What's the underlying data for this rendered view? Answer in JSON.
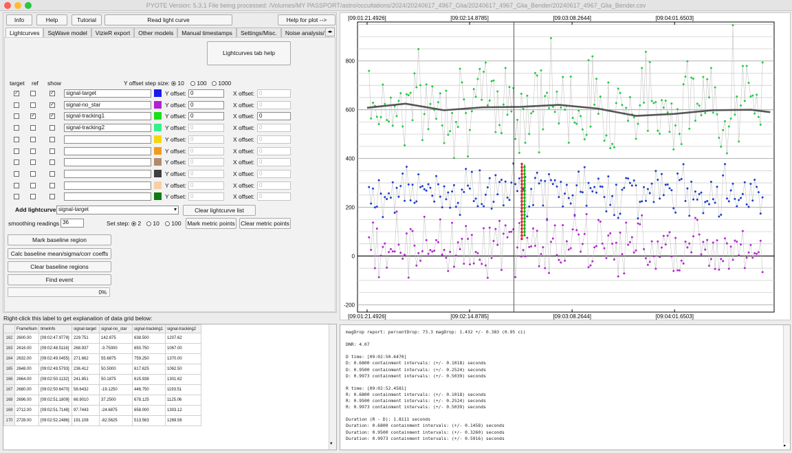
{
  "window": {
    "title": "PYOTE Version: 5.3.1  File being processed: /Volumes/MY PASSPORT/astro/occultations/2024/20240617_4967_Glia/20240617_4967_Glia_Bender/20240617_4967_Glia_Bender.csv"
  },
  "toolbar": {
    "info": "Info",
    "help": "Help",
    "tutorial": "Tutorial",
    "read": "Read light curve",
    "help_plot": "Help for plot -->"
  },
  "tabs": [
    "Lightcurves",
    "SqWave model",
    "VizieR export",
    "Other models",
    "Manual timestamps",
    "Settings/Misc.",
    "Noise analysis/"
  ],
  "lc_help": "Lightcurves tab help",
  "headers": {
    "target": "target",
    "ref": "ref",
    "show": "show"
  },
  "yoffset_label": "Y offset step size:",
  "yoffset_opts": [
    "10",
    "100",
    "1000"
  ],
  "row_labels": {
    "yoff": "Y offset:",
    "xoff": "X offset:"
  },
  "rows": [
    {
      "target": "✓",
      "ref": "",
      "show": "✓",
      "name": "signal-target",
      "color": "#1a1aee",
      "yoff": "0",
      "xoff": "0"
    },
    {
      "target": "",
      "ref": "",
      "show": "✓",
      "name": "signal-no_star",
      "color": "#b51ed6",
      "yoff": "0",
      "xoff": "0"
    },
    {
      "target": "",
      "ref": "✓",
      "show": "✓",
      "name": "signal-tracking1",
      "color": "#18e018",
      "yoff": "0",
      "xoff": "0"
    },
    {
      "target": "",
      "ref": "",
      "show": "",
      "name": "signal-tracking2",
      "color": "#36f08c",
      "yoff": "0",
      "xoff": "0"
    },
    {
      "target": "",
      "ref": "",
      "show": "",
      "name": "",
      "color": "#f5d50e",
      "yoff": "0",
      "xoff": "0"
    },
    {
      "target": "",
      "ref": "",
      "show": "",
      "name": "",
      "color": "#f09c1a",
      "yoff": "0",
      "xoff": "0"
    },
    {
      "target": "",
      "ref": "",
      "show": "",
      "name": "",
      "color": "#b48a6a",
      "yoff": "0",
      "xoff": "0"
    },
    {
      "target": "",
      "ref": "",
      "show": "",
      "name": "",
      "color": "#3e3e3e",
      "yoff": "0",
      "xoff": "0"
    },
    {
      "target": "",
      "ref": "",
      "show": "",
      "name": "",
      "color": "#f8cfa8",
      "yoff": "0",
      "xoff": "0"
    },
    {
      "target": "",
      "ref": "",
      "show": "",
      "name": "",
      "color": "#0f7a0f",
      "yoff": "0",
      "xoff": "0"
    }
  ],
  "add_lc": {
    "label": "Add lightcurve",
    "value": "signal-target",
    "clear": "Clear lightcurve list"
  },
  "smoothing": {
    "label": "smoothing readings",
    "value": "36"
  },
  "set_step": {
    "label": "Set step:",
    "opts": [
      "2",
      "10",
      "100"
    ]
  },
  "mark_metric": "Mark metric points",
  "clear_metric": "Clear metric points",
  "baseline": {
    "mark": "Mark baseline region",
    "calc": "Calc baseline mean/sigma/corr coeffs",
    "clear": "Clear baseline regions"
  },
  "find_event": "Find event",
  "progress": {
    "label": "0%",
    "value": 0
  },
  "grid_label": "Right-click this label to get explanation of data grid below:",
  "grid": {
    "columns": [
      "FrameNum",
      "timeInfo",
      "signal-target",
      "signal-no_star",
      "signal-tracking1",
      "signal-tracking2"
    ],
    "rows": [
      [
        "162",
        "2600.00",
        "[09:02:47.9778]",
        "229.751",
        "142.875",
        "638.500",
        "1207.62"
      ],
      [
        "163",
        "2616.00",
        "[09:02:48.5116]",
        "268.937",
        "-3.75000",
        "650.750",
        "1067.00"
      ],
      [
        "164",
        "2632.00",
        "[09:02:49.0455]",
        "271.662",
        "55.6875",
        "759.250",
        "1370.00"
      ],
      [
        "165",
        "2648.00",
        "[09:02:49.5793]",
        "236.412",
        "50.5000",
        "617.625",
        "1062.50"
      ],
      [
        "166",
        "2664.00",
        "[09:02:50.1132]",
        "241.851",
        "50.1875",
        "615.938",
        "1301.62"
      ],
      [
        "167",
        "2680.00",
        "[09:02:50.6470]",
        "58.6432",
        "-19.1250",
        "446.750",
        "1193.51"
      ],
      [
        "168",
        "2696.00",
        "[09:02:51.1809]",
        "66.9010",
        "37.2500",
        "678.125",
        "1125.06"
      ],
      [
        "169",
        "2712.00",
        "[09:02:51.7148]",
        "97.7443",
        "-24.6875",
        "658.000",
        "1303.12"
      ],
      [
        "170",
        "2728.00",
        "[09:02:52.2486]",
        "191.108",
        "-82.5625",
        "513.563",
        "1269.56"
      ]
    ]
  },
  "report_lines": [
    "magDrop report: percentDrop: 73.3 magDrop: 1.432 +/- 0.383 (0.95 ci)",
    "",
    "DNR: 4.07",
    "",
    "D time: [09:02:50.6470]",
    "D: 0.6800 containment intervals: (+/- 0.1018) seconds",
    "D: 0.9500 containment intervals: (+/- 0.2524) seconds",
    "D: 0.9973 containment intervals: (+/- 0.5039) seconds",
    "",
    "R time: [09:02:52.4581]",
    "R: 0.6800 containment intervals: (+/- 0.1018) seconds",
    "R: 0.9500 containment intervals: (+/- 0.2524) seconds",
    "R: 0.9973 containment intervals: (+/- 0.5039) seconds",
    "",
    "Duration (R - D): 1.8111 seconds",
    "Duration: 0.6800 containment intervals: (+/- 0.1458) seconds",
    "Duration: 0.9500 containment intervals: (+/- 0.3260) seconds",
    "Duration: 0.9973 containment intervals: (+/- 0.5916) seconds"
  ],
  "chart_data": {
    "type": "scatter",
    "x_ticks": [
      "[09:01:21.4926]",
      "[09:02:14.8785]",
      "[09:03:08.2644]",
      "[09:04:01.6503]"
    ],
    "y_ticks": [
      "800",
      "600",
      "400",
      "200",
      "0",
      "-200"
    ],
    "ylim": [
      -230,
      960
    ],
    "x_range_seconds": [
      -5,
      212
    ],
    "grid": true,
    "series": [
      {
        "color": "#22cc44",
        "mean": 620,
        "spread": 140
      },
      {
        "color": "#1c3fcf",
        "mean": 265,
        "spread": 75
      },
      {
        "color": "#b42ad1",
        "mean": 45,
        "spread": 95
      }
    ],
    "smoothed": {
      "color": "#555555",
      "x": [
        0,
        20,
        40,
        60,
        80,
        100,
        120,
        140,
        160,
        180,
        200,
        210
      ],
      "y": [
        608,
        625,
        598,
        610,
        612,
        620,
        605,
        575,
        583,
        598,
        600,
        590
      ]
    },
    "cursor_x_seconds": 76.5,
    "event_marks": [
      {
        "color": "#e02020",
        "x_seconds": 80.6,
        "y_range": [
          70,
          380
        ]
      },
      {
        "color": "#16b016",
        "x_seconds": 82.0,
        "y_range": [
          85,
          375
        ]
      }
    ]
  }
}
